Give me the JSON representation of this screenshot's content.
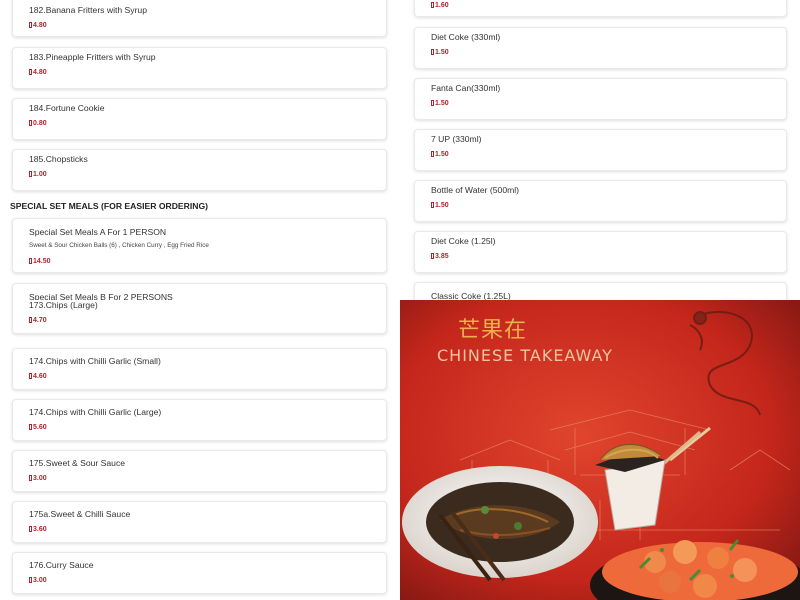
{
  "currency_icon": "pound-glyph-missing-box",
  "colors": {
    "price": "#b0232a",
    "photo_bg": "#c8281c",
    "brand_cn": "#e9b24a"
  },
  "top_left": {
    "items": [
      {
        "name": "182.Banana Fritters with Syrup",
        "price": "4.80"
      },
      {
        "name": "183.Pineapple Fritters with Syrup",
        "price": "4.80"
      },
      {
        "name": "184.Fortune Cookie",
        "price": "0.80"
      },
      {
        "name": "185.Chopsticks",
        "price": "1.00"
      }
    ],
    "section_heading": "SPECIAL SET MEALS (FOR EASIER ORDERING)",
    "set_meal_a": {
      "name": "Special Set Meals A For 1 PERSON",
      "description": "Sweet & Sour Chicken Balls (6) , Chicken Curry , Egg Fried Rice",
      "price": "14.50"
    },
    "set_meal_b": {
      "name": "Special Set Meals B For 2 PERSONS"
    }
  },
  "top_right": {
    "partial_price": "1.60",
    "items": [
      {
        "name": "Diet Coke (330ml)",
        "price": "1.50"
      },
      {
        "name": "Fanta Can(330ml)",
        "price": "1.50"
      },
      {
        "name": "7 UP (330ml)",
        "price": "1.50"
      },
      {
        "name": "Bottle of Water (500ml)",
        "price": "1.50"
      },
      {
        "name": "Diet Coke (1.25l)",
        "price": "3.85"
      }
    ],
    "partial_item": "Classic Coke (1.25L)"
  },
  "bottom_left": {
    "items": [
      {
        "name": "173.Chips (Large)",
        "price": "4.70"
      },
      {
        "name": "174.Chips with Chilli Garlic (Small)",
        "price": "4.60"
      },
      {
        "name": "174.Chips with Chilli Garlic (Large)",
        "price": "5.60"
      },
      {
        "name": "175.Sweet & Sour Sauce",
        "price": "3.00"
      },
      {
        "name": "175a.Sweet & Chilli Sauce",
        "price": "3.60"
      },
      {
        "name": "176.Curry Sauce",
        "price": "3.00"
      }
    ]
  },
  "bottom_right": {
    "brand_chinese": "芒果在",
    "brand_english": "CHINESE TAKEAWAY",
    "icons": [
      "dragon-illustration",
      "pagoda-illustration",
      "noodle-plate-photo",
      "takeaway-box-photo",
      "prawn-dish-photo",
      "chopsticks-photo"
    ]
  }
}
